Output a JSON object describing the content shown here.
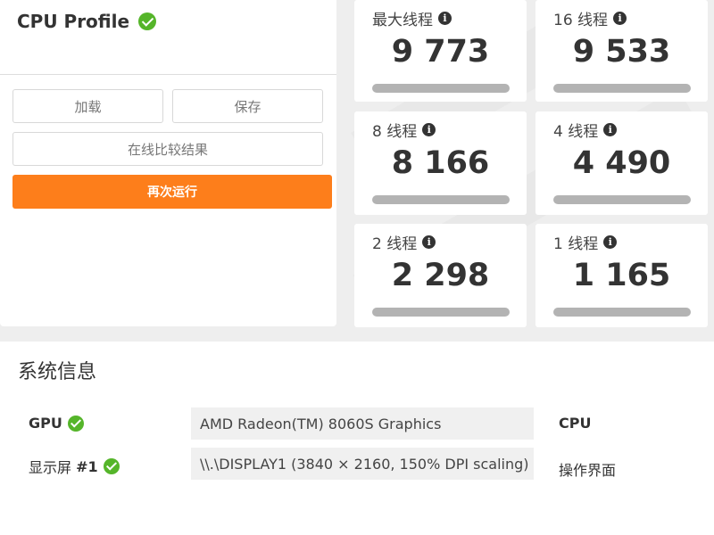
{
  "panel": {
    "title": "CPU Profile",
    "buttons": {
      "load": "加载",
      "save": "保存",
      "compare": "在线比较结果",
      "run": "再次运行"
    }
  },
  "tiles": [
    {
      "label": "最大线程",
      "value": "9 773"
    },
    {
      "label": "16 线程",
      "value": "9 533"
    },
    {
      "label": "8 线程",
      "value": "8 166"
    },
    {
      "label": "4 线程",
      "value": "4 490"
    },
    {
      "label": "2 线程",
      "value": "2 298"
    },
    {
      "label": "1 线程",
      "value": "1 165"
    }
  ],
  "info_icon_glyph": "i",
  "system_info": {
    "title": "系统信息",
    "rows": [
      {
        "label": "GPU",
        "value": "AMD Radeon(TM) 8060S Graphics",
        "right": "CPU"
      },
      {
        "label_prefix": "显示屏 ",
        "label_suffix": "#1",
        "value": "\\\\.\\DISPLAY1 (3840 × 2160, 150% DPI scaling)",
        "right": "操作界面"
      }
    ]
  },
  "colors": {
    "accent_orange": "#fd7e1b",
    "check_green": "#55b52a",
    "background": "#eeeeee"
  }
}
